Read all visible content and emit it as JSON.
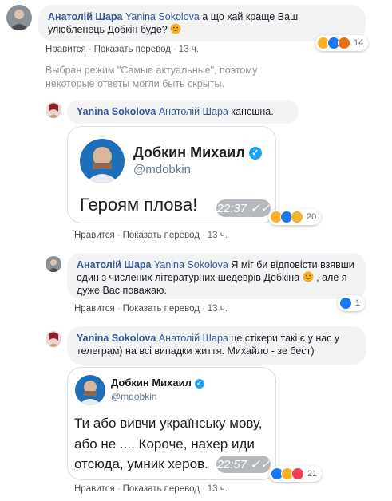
{
  "colors": {
    "author_blue": "#385898",
    "bubble_bg": "#f2f3f5",
    "meta_gray": "#606770",
    "like_blue": "#1877f2",
    "haha_yellow": "#f7b125",
    "angry_orange": "#e9710f",
    "love_red": "#f33e58",
    "verified_blue": "#1da1f2"
  },
  "actions": {
    "like": "Нравится",
    "translate": "Показать перевод",
    "separator": "·"
  },
  "notice": "Выбран режим \"Самые актуальные\", поэтому некоторые ответы могли быть скрыты.",
  "comments": [
    {
      "author": "Анатолій Шара",
      "mention": "Yanina Sokolova",
      "text": "а що хай краще Ваш улюбленець Добкін буде?",
      "emoji": "smiling-face-icon",
      "time": "13 ч.",
      "reactions": {
        "icons": [
          "haha-icon",
          "like-icon",
          "angry-icon"
        ],
        "count": "14"
      }
    },
    {
      "author": "Yanina Sokolova",
      "mention": "Анатолій Шара",
      "text": "канєшна.",
      "time": "13 ч.",
      "reactions": {
        "icons": [
          "haha-icon",
          "like-icon",
          "sad-icon"
        ],
        "count": "20"
      },
      "sticker": {
        "name": "Добкин Михаил",
        "handle": "@mdobkin",
        "message": "Героям плова!",
        "time": "22:37"
      }
    },
    {
      "author": "Анатолій Шара",
      "mention": "Yanina Sokolova",
      "text1": "Я міг би відповісти взявши один з числених літературних шедеврів Добкіна",
      "text2": ", але я дуже Вас поважаю.",
      "emoji": "smiling-face-icon",
      "time": "13 ч.",
      "reactions": {
        "icons": [
          "like-icon"
        ],
        "count": "1"
      }
    },
    {
      "author": "Yanina Sokolova",
      "mention": "Анатолій Шара",
      "text": "це стікери такі є у нас у телеграм) на всі випадки життя. Михайло - зе бест)",
      "time": "13 ч.",
      "reactions": {
        "icons": [
          "like-icon",
          "haha-icon",
          "love-icon"
        ],
        "count": "21"
      },
      "sticker": {
        "name": "Добкин Михаил",
        "handle": "@mdobkin",
        "line1": "Ти або вивчи українську мову,",
        "line2": "або не .... Короче, нахер иди",
        "line3": "отсюда, умник херов.",
        "time": "22:57"
      }
    }
  ]
}
